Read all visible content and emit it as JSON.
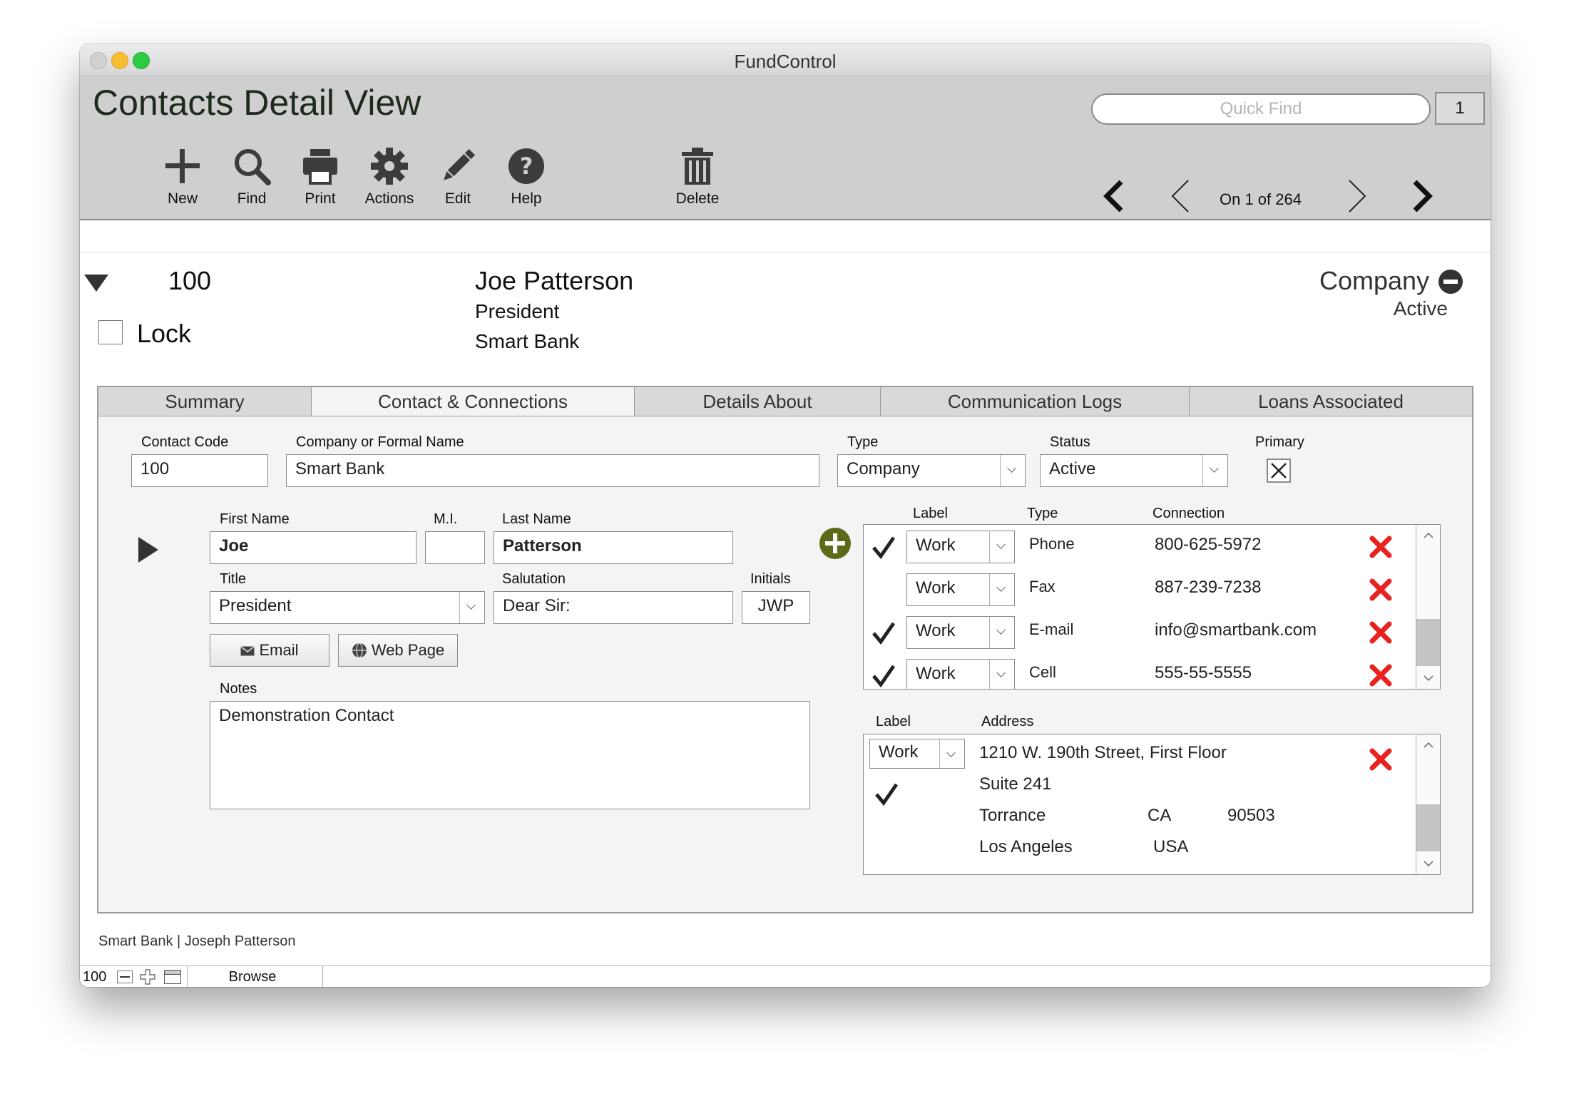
{
  "window": {
    "title": "FundControl"
  },
  "header": {
    "page_title": "Contacts Detail View",
    "quick_find_placeholder": "Quick Find",
    "found_count": "1",
    "record_nav": "On 1 of 264",
    "toolbar": [
      {
        "label": "New",
        "icon": "plus-icon"
      },
      {
        "label": "Find",
        "icon": "magnifier-icon"
      },
      {
        "label": "Print",
        "icon": "printer-icon"
      },
      {
        "label": "Actions",
        "icon": "gear-icon"
      },
      {
        "label": "Edit",
        "icon": "pencil-icon"
      },
      {
        "label": "Help",
        "icon": "question-icon"
      },
      {
        "label": "Delete",
        "icon": "trash-icon"
      }
    ]
  },
  "record": {
    "number": "100",
    "lock_label": "Lock",
    "name": "Joe Patterson",
    "title": "President",
    "company": "Smart Bank",
    "type": "Company",
    "status": "Active"
  },
  "tabs": [
    "Summary",
    "Contact & Connections",
    "Details About",
    "Communication Logs",
    "Loans Associated"
  ],
  "active_tab": 1,
  "form": {
    "labels": {
      "contact_code": "Contact Code",
      "company_name": "Company or Formal Name",
      "type": "Type",
      "status": "Status",
      "primary": "Primary",
      "first_name": "First Name",
      "mi": "M.I.",
      "last_name": "Last Name",
      "title": "Title",
      "salutation": "Salutation",
      "initials": "Initials",
      "notes": "Notes"
    },
    "contact_code": "100",
    "company_name": "Smart Bank",
    "type": "Company",
    "status": "Active",
    "primary_checked": true,
    "first_name": "Joe",
    "mi": "",
    "last_name": "Patterson",
    "title": "President",
    "salutation": "Dear Sir:",
    "initials": "JWP",
    "email_button": "Email",
    "webpage_button": "Web Page",
    "notes": "Demonstration Contact"
  },
  "connections": {
    "headers": {
      "label": "Label",
      "type": "Type",
      "connection": "Connection"
    },
    "rows": [
      {
        "checked": true,
        "label": "Work",
        "type": "Phone",
        "value": "800-625-5972"
      },
      {
        "checked": false,
        "label": "Work",
        "type": "Fax",
        "value": "887-239-7238"
      },
      {
        "checked": true,
        "label": "Work",
        "type": "E-mail",
        "value": "info@smartbank.com"
      },
      {
        "checked": true,
        "label": "Work",
        "type": "Cell",
        "value": "555-55-5555"
      }
    ]
  },
  "address": {
    "headers": {
      "label": "Label",
      "address": "Address"
    },
    "label": "Work",
    "line1": "1210 W. 190th Street, First Floor",
    "line2": "Suite 241",
    "city": "Torrance",
    "state": "CA",
    "zip": "90503",
    "county": "Los Angeles",
    "country": "USA",
    "checked": true
  },
  "footer": {
    "summary": "Smart Bank | Joseph Patterson",
    "record_count": "100",
    "mode": "Browse"
  },
  "colors": {
    "header_bg": "#cfcfcf",
    "red_x": "#e8231f",
    "add_green": "#5b6b1a"
  }
}
